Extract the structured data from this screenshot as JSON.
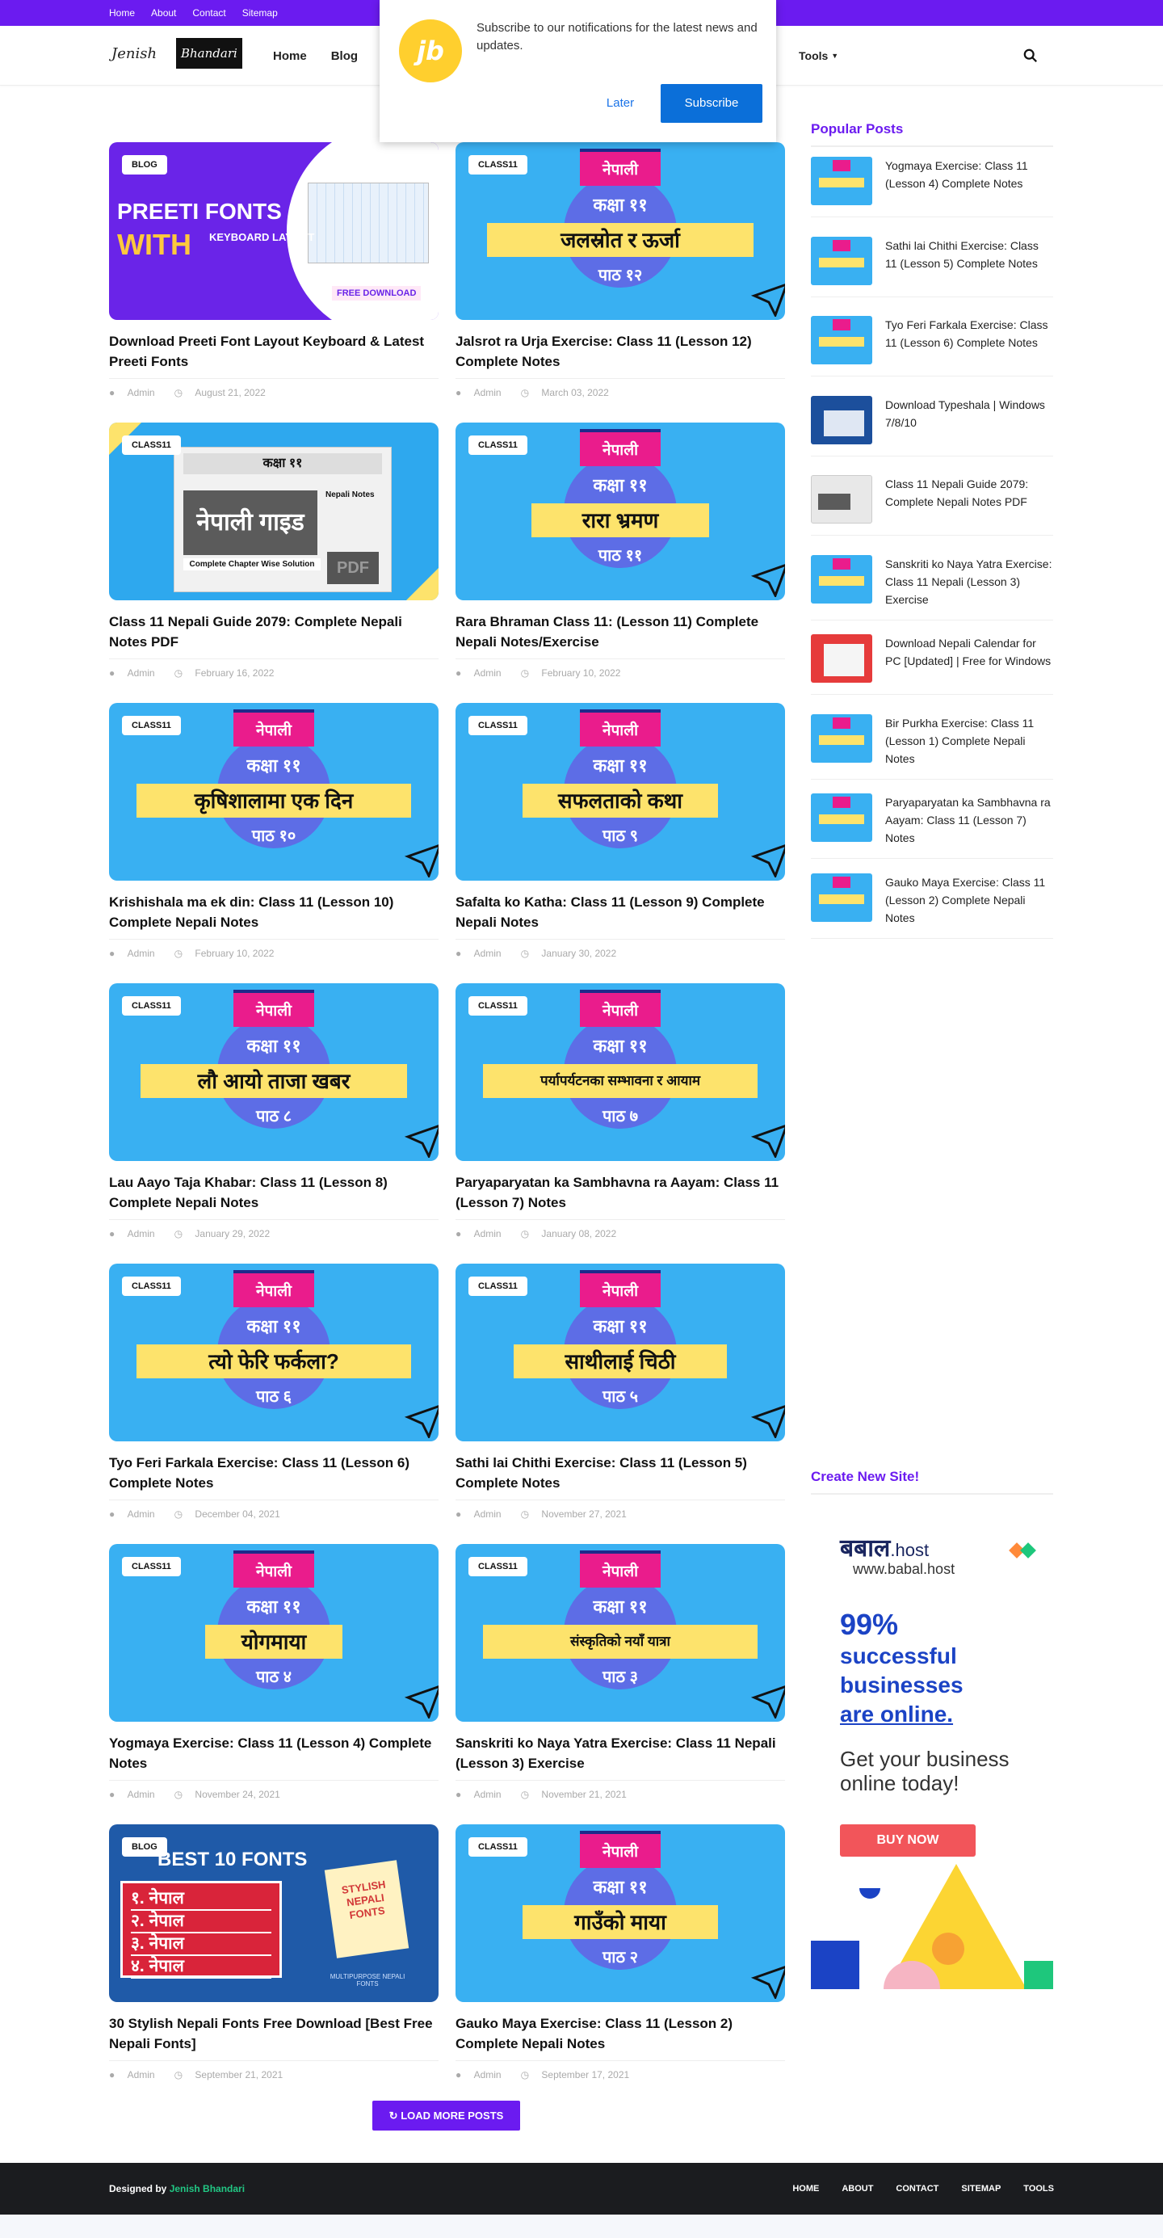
{
  "topbar": {
    "links": [
      "Home",
      "About",
      "Contact",
      "Sitemap"
    ]
  },
  "header": {
    "logo_signature": "Jenish",
    "logo_name": "Bhandari",
    "nav": [
      "Home",
      "Blog"
    ],
    "tools_label": "Tools"
  },
  "notification": {
    "logo_text": "jb",
    "message": "Subscribe to our notifications for the latest news and updates.",
    "later_label": "Later",
    "subscribe_label": "Subscribe"
  },
  "posts": [
    {
      "label": "BLOG",
      "title": "Download Preeti Font Layout Keyboard & Latest Preeti Fonts",
      "author": "Admin",
      "date": "August 21, 2022",
      "thumb": {
        "l1": "PREETI FONTS",
        "l2": "WITH",
        "l3": "KEYBOARD LAYOUT",
        "dl": "FREE DOWNLOAD"
      }
    },
    {
      "label": "CLASS11",
      "title": "Jalsrot ra Urja Exercise: Class 11 (Lesson 12) Complete Notes",
      "author": "Admin",
      "date": "March 03, 2022",
      "thumb": {
        "badge": "नेपाली",
        "kaksha": "कक्षा ११",
        "name": "जलस्रोत र ऊर्जा",
        "path": "पाठ १२"
      }
    },
    {
      "label": "CLASS11",
      "title": "Class 11 Nepali Guide 2079: Complete Nepali Notes PDF",
      "author": "Admin",
      "date": "February 16, 2022",
      "thumb": {
        "head": "कक्षा ११",
        "main": "नेपाली गाइड",
        "notes": "Nepali Notes",
        "strip": "Complete Chapter Wise Solution",
        "pdf": "PDF"
      }
    },
    {
      "label": "CLASS11",
      "title": "Rara Bhraman Class 11: (Lesson 11) Complete Nepali Notes/Exercise",
      "author": "Admin",
      "date": "February 10, 2022",
      "thumb": {
        "badge": "नेपाली",
        "kaksha": "कक्षा ११",
        "name": "रारा भ्रमण",
        "path": "पाठ ११"
      }
    },
    {
      "label": "CLASS11",
      "title": "Krishishala ma ek din: Class 11 (Lesson 10) Complete Nepali Notes",
      "author": "Admin",
      "date": "February 10, 2022",
      "thumb": {
        "badge": "नेपाली",
        "kaksha": "कक्षा ११",
        "name": "कृषिशालामा एक दिन",
        "path": "पाठ १०"
      }
    },
    {
      "label": "CLASS11",
      "title": "Safalta ko Katha: Class 11 (Lesson 9) Complete Nepali Notes",
      "author": "Admin",
      "date": "January 30, 2022",
      "thumb": {
        "badge": "नेपाली",
        "kaksha": "कक्षा ११",
        "name": "सफलताको कथा",
        "path": "पाठ ९"
      }
    },
    {
      "label": "CLASS11",
      "title": "Lau Aayo Taja Khabar: Class 11 (Lesson 8) Complete Nepali Notes",
      "author": "Admin",
      "date": "January 29, 2022",
      "thumb": {
        "badge": "नेपाली",
        "kaksha": "कक्षा ११",
        "name": "लौ आयो ताजा खबर",
        "path": "पाठ ८"
      }
    },
    {
      "label": "CLASS11",
      "title": "Paryaparyatan ka Sambhavna ra Aayam: Class 11 (Lesson 7) Notes",
      "author": "Admin",
      "date": "January 08, 2022",
      "thumb": {
        "badge": "नेपाली",
        "kaksha": "कक्षा ११",
        "name": "पर्यापर्यटनका सम्भावना र आयाम",
        "path": "पाठ ७"
      }
    },
    {
      "label": "CLASS11",
      "title": "Tyo Feri Farkala Exercise: Class 11 (Lesson 6) Complete Notes",
      "author": "Admin",
      "date": "December 04, 2021",
      "thumb": {
        "badge": "नेपाली",
        "kaksha": "कक्षा ११",
        "name": "त्यो फेरि फर्कला?",
        "path": "पाठ ६"
      }
    },
    {
      "label": "CLASS11",
      "title": "Sathi lai Chithi Exercise: Class 11 (Lesson 5) Complete Notes",
      "author": "Admin",
      "date": "November 27, 2021",
      "thumb": {
        "badge": "नेपाली",
        "kaksha": "कक्षा ११",
        "name": "साथीलाई चिठी",
        "path": "पाठ ५"
      }
    },
    {
      "label": "CLASS11",
      "title": "Yogmaya Exercise: Class 11 (Lesson 4) Complete Notes",
      "author": "Admin",
      "date": "November 24, 2021",
      "thumb": {
        "badge": "नेपाली",
        "kaksha": "कक्षा ११",
        "name": "योगमाया",
        "path": "पाठ ४"
      }
    },
    {
      "label": "CLASS11",
      "title": "Sanskriti ko Naya Yatra Exercise: Class 11 Nepali (Lesson 3) Exercise",
      "author": "Admin",
      "date": "November 21, 2021",
      "thumb": {
        "badge": "नेपाली",
        "kaksha": "कक्षा ११",
        "name": "संस्कृतिको नयाँ यात्रा",
        "path": "पाठ ३"
      }
    },
    {
      "label": "BLOG",
      "title": "30 Stylish Nepali Fonts Free Download [Best Free Nepali Fonts]",
      "author": "Admin",
      "date": "September 21, 2021",
      "thumb": {
        "title": "BEST 10 FONTS",
        "items": [
          "१. नेपाल",
          "२. नेपाल",
          "३. नेपाल",
          "४. नेपाल"
        ],
        "note": "STYLISH NEPALI FONTS",
        "small": "MULTIPURPOSE NEPALI FONTS"
      }
    },
    {
      "label": "CLASS11",
      "title": "Gauko Maya Exercise: Class 11 (Lesson 2) Complete Nepali Notes",
      "author": "Admin",
      "date": "September 17, 2021",
      "thumb": {
        "badge": "नेपाली",
        "kaksha": "कक्षा ११",
        "name": "गाउँको माया",
        "path": "पाठ २"
      }
    }
  ],
  "load_more_label": "LOAD MORE POSTS",
  "sidebar": {
    "popular_heading": "Popular Posts",
    "popular": [
      {
        "title": "Yogmaya Exercise: Class 11 (Lesson 4) Complete Notes",
        "thumb": "b"
      },
      {
        "title": "Sathi lai Chithi Exercise: Class 11 (Lesson 5) Complete Notes",
        "thumb": "b"
      },
      {
        "title": "Tyo Feri Farkala Exercise: Class 11 (Lesson 6) Complete Notes",
        "thumb": "b"
      },
      {
        "title": "Download Typeshala | Windows 7/8/10",
        "thumb": "win"
      },
      {
        "title": "Class 11 Nepali Guide 2079: Complete Nepali Notes PDF",
        "thumb": "g"
      },
      {
        "title": "Sanskriti ko Naya Yatra Exercise: Class 11 Nepali (Lesson 3) Exercise",
        "thumb": "b"
      },
      {
        "title": "Download Nepali Calendar for PC [Updated] | Free for Windows",
        "thumb": "cal"
      },
      {
        "title": "Bir Purkha Exercise: Class 11 (Lesson 1) Complete Nepali Notes",
        "thumb": "b"
      },
      {
        "title": "Paryaparyatan ka Sambhavna ra Aayam: Class 11 (Lesson 7) Notes",
        "thumb": "b"
      },
      {
        "title": "Gauko Maya Exercise: Class 11 (Lesson 2) Complete Nepali Notes",
        "thumb": "b"
      }
    ],
    "create_heading": "Create New Site!",
    "ad": {
      "logo_main": "बबाल",
      "logo_suffix": ".host",
      "url": "www.babal.host",
      "pct": "99%",
      "line1": "successful",
      "line2": "businesses",
      "line3": "are online.",
      "sub": "Get your business online today!",
      "button": "BUY NOW"
    }
  },
  "footer": {
    "designed_by": "Designed by",
    "author": "Jenish Bhandari",
    "links": [
      "HOME",
      "ABOUT",
      "CONTACT",
      "SITEMAP",
      "TOOLS"
    ]
  },
  "colors": {
    "brand": "#6b1bf0",
    "accent_green": "#22c784",
    "thumb_blue": "#39b0f2"
  }
}
